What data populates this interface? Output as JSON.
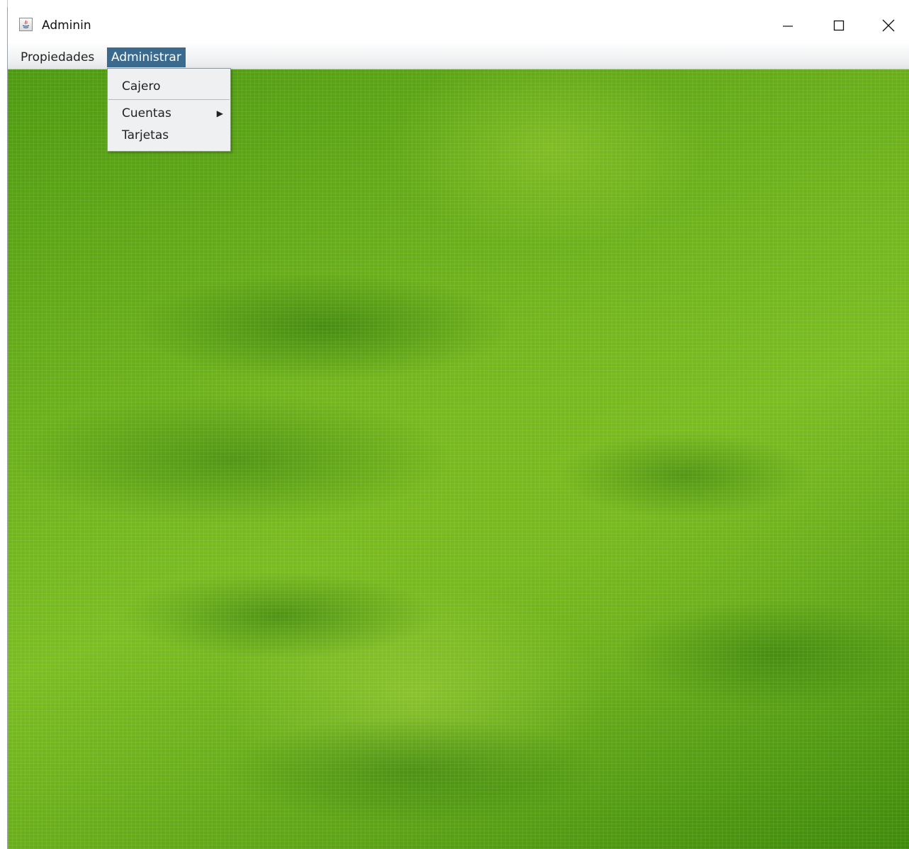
{
  "window": {
    "title": "Adminin",
    "minimize_icon": "minimize-icon",
    "maximize_icon": "maximize-icon",
    "close_icon": "close-icon"
  },
  "menubar": {
    "items": [
      {
        "label": "Propiedades"
      },
      {
        "label": "Administrar",
        "active": true
      }
    ]
  },
  "dropdown": {
    "items": [
      {
        "label": "Cajero"
      },
      {
        "label": "Cuentas",
        "submenu": true,
        "submenu_icon": "triangle-right-icon"
      },
      {
        "label": "Tarjetas"
      }
    ]
  },
  "colors": {
    "menu_highlight": "#3a6a8e",
    "background_green": "#6aae1c"
  }
}
